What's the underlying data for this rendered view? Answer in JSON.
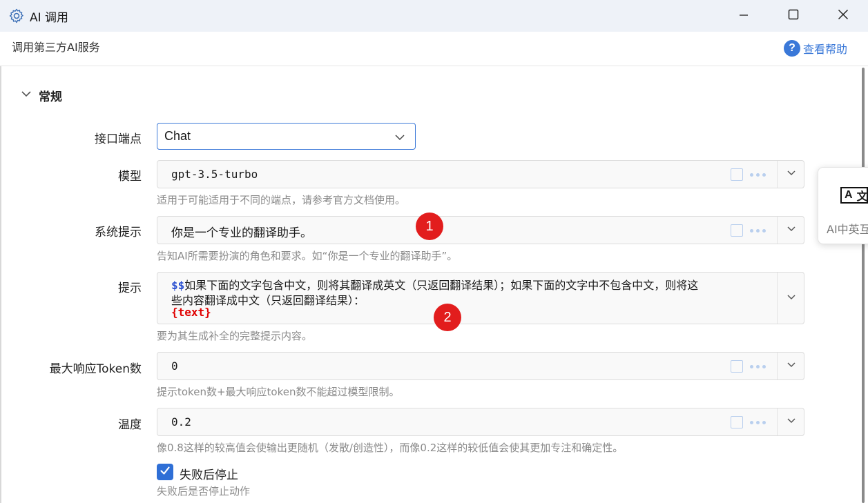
{
  "window": {
    "title": "AI 调用",
    "subtitle": "调用第三方AI服务",
    "help_label": "查看帮助",
    "help_glyph": "?"
  },
  "section": {
    "title": "常规",
    "expanded": true
  },
  "fields": {
    "endpoint": {
      "label": "接口端点",
      "value": "Chat"
    },
    "model": {
      "label": "模型",
      "value": "gpt-3.5-turbo",
      "hint": "适用于可能适用于不同的端点，请参考官方文档使用。"
    },
    "system_prompt": {
      "label": "系统提示",
      "value": "你是一个专业的翻译助手。",
      "hint": "告知AI所需要扮演的角色和要求。如“你是一个专业的翻译助手”。"
    },
    "prompt": {
      "label": "提示",
      "var_prefix": "$$",
      "line1": "如果下面的文字包含中文，则将其翻译成英文（只返回翻译结果）；如果下面的文字中不包含中文，则将这",
      "line2": "些内容翻译成中文（只返回翻译结果）：",
      "line3": "{text}",
      "hint": "要为其生成补全的完整提示内容。"
    },
    "max_tokens": {
      "label": "最大响应Token数",
      "value": "0",
      "hint": "提示token数+最大响应token数不能超过模型限制。"
    },
    "temperature": {
      "label": "温度",
      "value": "0.2",
      "hint": "像0.8这样的较高值会使输出更随机（发散/创造性），而像0.2这样的较低值会使其更加专注和确定性。"
    },
    "stop_on_fail": {
      "label": "失败后停止",
      "checked": true,
      "hint": "失败后是否停止动作"
    }
  },
  "annotations": {
    "badge1": "1",
    "badge2": "2"
  },
  "side_card": {
    "glyph_a": "A",
    "glyph_b": "文",
    "label": "AI中英互"
  },
  "colors": {
    "accent": "#3a78d8",
    "badge": "#e21d1d",
    "checkbox": "#2f6fd6",
    "var": "#e00000"
  }
}
